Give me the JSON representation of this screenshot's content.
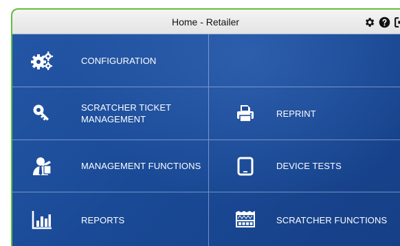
{
  "header": {
    "title": "Home - Retailer",
    "icons": [
      "gear-icon",
      "help-icon",
      "logout-icon"
    ]
  },
  "tiles": {
    "configuration": {
      "label": "CONFIGURATION",
      "icon": "gears-icon"
    },
    "blank": {
      "label": ""
    },
    "scratcher_ticket_management": {
      "label": "SCRATCHER TICKET MANAGEMENT",
      "icon": "key-icon"
    },
    "reprint": {
      "label": "REPRINT",
      "icon": "printer-icon"
    },
    "management_functions": {
      "label": "MANAGEMENT FUNCTIONS",
      "icon": "manager-icon"
    },
    "device_tests": {
      "label": "DEVICE TESTS",
      "icon": "tablet-icon"
    },
    "reports": {
      "label": "REPORTS",
      "icon": "bar-chart-icon"
    },
    "scratcher_functions": {
      "label": "SCRATCHER FUNCTIONS",
      "icon": "scratcher-ticket-icon"
    }
  },
  "colors": {
    "accent_border": "#5fbf3a",
    "tile_background": "#1c4e9a",
    "tile_text": "#ffffff"
  }
}
